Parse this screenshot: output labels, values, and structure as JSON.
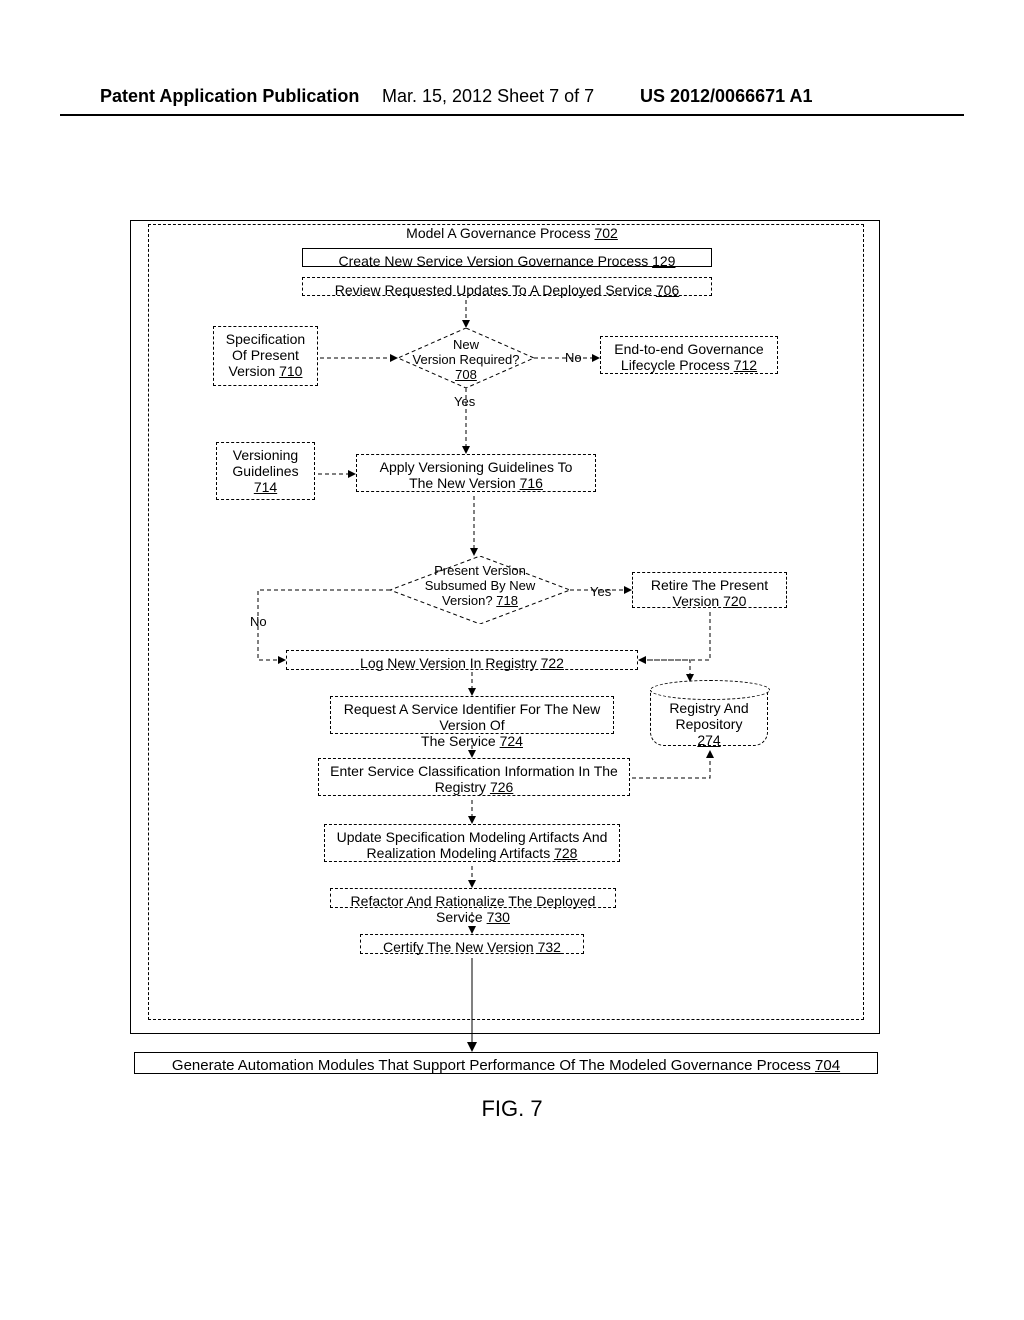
{
  "header": {
    "left": "Patent Application Publication",
    "mid": "Mar. 15, 2012   Sheet 7 of 7",
    "right": "US 2012/0066671 A1"
  },
  "figure_label": "FIG. 7",
  "model_a": {
    "title": "Model A Governance Process",
    "ref": "702"
  },
  "proc_129": {
    "title": "Create New Service Version Governance Process",
    "ref": "129"
  },
  "box_706": {
    "title": "Review Requested Updates To A Deployed Service",
    "ref": "706"
  },
  "box_710": {
    "line1": "Specification",
    "line2": "Of Present",
    "line3": "Version",
    "ref": "710"
  },
  "box_712": {
    "line1": "End-to-end Governance",
    "line2": "Lifecycle Process",
    "ref": "712"
  },
  "box_714": {
    "line1": "Versioning",
    "line2": "Guidelines",
    "ref": "714"
  },
  "box_716": {
    "line1": "Apply Versioning Guidelines To",
    "line2": "The New Version",
    "ref": "716"
  },
  "box_720": {
    "line1": "Retire The Present",
    "line2": "Version",
    "ref": "720"
  },
  "box_722": {
    "title": "Log New Version In Registry",
    "ref": "722"
  },
  "box_724": {
    "line1": "Request A Service Identifier For The New Version Of",
    "line2": "The Service",
    "ref": "724"
  },
  "box_726": {
    "line1": "Enter Service Classification Information In The",
    "line2": "Registry",
    "ref": "726"
  },
  "box_728": {
    "line1": "Update Specification Modeling Artifacts And",
    "line2": "Realization Modeling Artifacts",
    "ref": "728"
  },
  "box_730": {
    "title": "Refactor And Rationalize The Deployed Service",
    "ref": "730"
  },
  "box_732": {
    "title": "Certify The New Version",
    "ref": "732"
  },
  "cyl_274": {
    "line1": "Registry And",
    "line2": "Repository",
    "ref": "274"
  },
  "d_708": {
    "line1": "New",
    "line2": "Version Required?",
    "ref": "708"
  },
  "d_718": {
    "line1": "Present Version",
    "line2": "Subsumed By New",
    "line3": "Version?",
    "ref": "718"
  },
  "labels": {
    "yes": "Yes",
    "no": "No"
  },
  "gen_704": {
    "title": "Generate Automation Modules That Support Performance Of The Modeled Governance Process",
    "ref": "704"
  }
}
